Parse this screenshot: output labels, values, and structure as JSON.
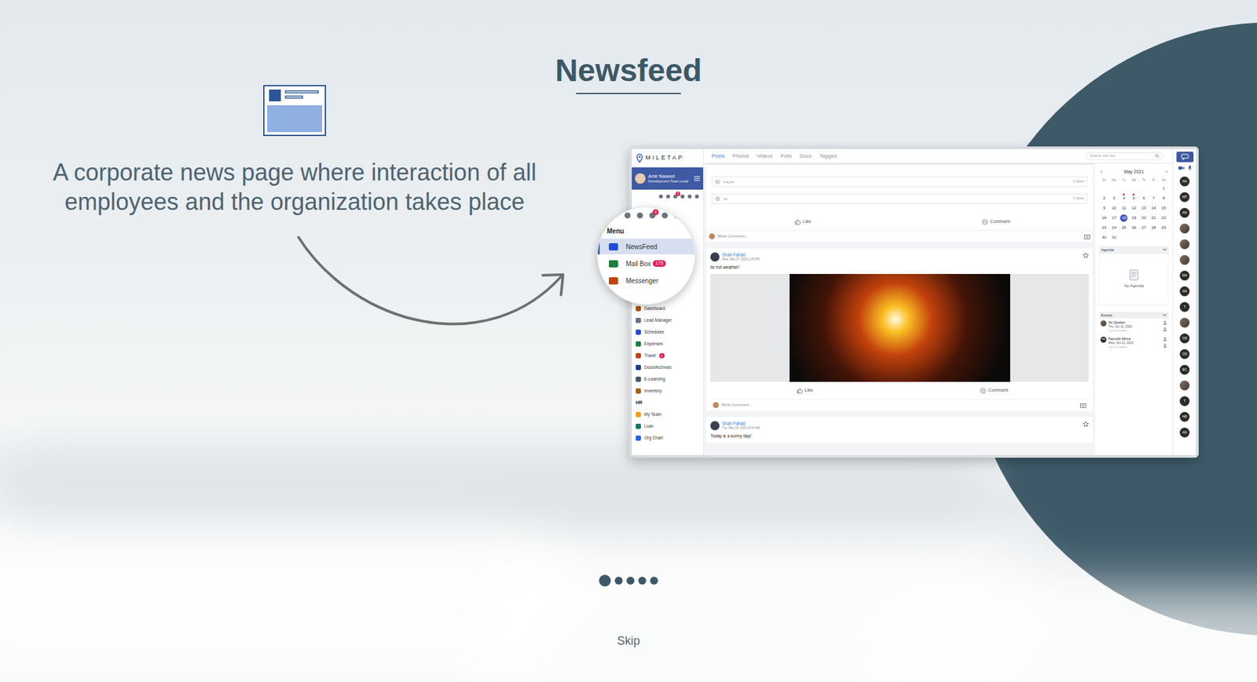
{
  "slide": {
    "title": "Newsfeed",
    "description": "A corporate news page where interaction of all employees and the organization takes place",
    "skip": "Skip"
  },
  "pager": [
    {
      "selected": true
    },
    {
      "selected": false
    },
    {
      "selected": false
    },
    {
      "selected": false
    },
    {
      "selected": false
    }
  ],
  "app": {
    "logo": "MILETAP",
    "user": {
      "name": "Amir Naveed",
      "role": "Development Team Lead"
    },
    "icon_badge": "2",
    "tabs": [
      {
        "label": "Posts",
        "selected": true
      },
      {
        "label": "Photos",
        "selected": false
      },
      {
        "label": "Videos",
        "selected": false
      },
      {
        "label": "Polls",
        "selected": false
      },
      {
        "label": "Docs",
        "selected": false
      },
      {
        "label": "Tagged",
        "selected": false
      }
    ],
    "search": {
      "placeholder": "Search with title"
    },
    "sidebar": [
      {
        "label": "Dashboard",
        "kind": "item"
      },
      {
        "label": "Lead Manager",
        "kind": "item"
      },
      {
        "label": "Schedules",
        "kind": "item"
      },
      {
        "label": "Expenses",
        "kind": "item"
      },
      {
        "label": "Travel",
        "kind": "item",
        "badge": "1"
      },
      {
        "label": "Docs/Archives",
        "kind": "item"
      },
      {
        "label": "E-Learning",
        "kind": "item"
      },
      {
        "label": "Inventory",
        "kind": "item"
      },
      {
        "label": "HR",
        "kind": "section"
      },
      {
        "label": "My Team",
        "kind": "item"
      },
      {
        "label": "Loan",
        "kind": "item"
      },
      {
        "label": "Org Chart",
        "kind": "item"
      }
    ],
    "poll": [
      {
        "option": "maybe",
        "votes": "0 Votes"
      },
      {
        "option": "no",
        "votes": "0 Votes"
      }
    ],
    "actions": {
      "like": "Like",
      "comment": "Comment",
      "write": "Write Comment..."
    },
    "posts": [
      {
        "author": "Shah Fahad",
        "time": "Wed, May 27, 2020 1:25 PM",
        "text": "its hot weather!",
        "kind": "image"
      },
      {
        "author": "Shah Fahad",
        "time": "Tue, May 19, 2020 10:14 AM",
        "text": "Today is a sunny day!",
        "kind": "text"
      }
    ],
    "calendar": {
      "month": "May 2021",
      "prev": "‹",
      "next": "›",
      "weekdays": [
        "Su",
        "Mo",
        "Tu",
        "We",
        "Th",
        "Fr",
        "Sa"
      ],
      "first_weekday": 6,
      "days": [
        {
          "label": "1",
          "selected": false,
          "marked": false
        },
        {
          "label": "2",
          "selected": false,
          "marked": false
        },
        {
          "label": "3",
          "selected": false,
          "marked": false
        },
        {
          "label": "4",
          "selected": false,
          "marked": true
        },
        {
          "label": "5",
          "selected": false,
          "marked": true
        },
        {
          "label": "6",
          "selected": false,
          "marked": false
        },
        {
          "label": "7",
          "selected": false,
          "marked": false
        },
        {
          "label": "8",
          "selected": false,
          "marked": false
        },
        {
          "label": "9",
          "selected": false,
          "marked": false
        },
        {
          "label": "10",
          "selected": false,
          "marked": false
        },
        {
          "label": "11",
          "selected": false,
          "marked": false
        },
        {
          "label": "12",
          "selected": false,
          "marked": false
        },
        {
          "label": "13",
          "selected": false,
          "marked": false
        },
        {
          "label": "14",
          "selected": false,
          "marked": false
        },
        {
          "label": "15",
          "selected": false,
          "marked": false
        },
        {
          "label": "16",
          "selected": false,
          "marked": false
        },
        {
          "label": "17",
          "selected": false,
          "marked": false
        },
        {
          "label": "18",
          "selected": true,
          "marked": false
        },
        {
          "label": "19",
          "selected": false,
          "marked": false
        },
        {
          "label": "20",
          "selected": false,
          "marked": false
        },
        {
          "label": "21",
          "selected": false,
          "marked": false
        },
        {
          "label": "22",
          "selected": false,
          "marked": false
        },
        {
          "label": "23",
          "selected": false,
          "marked": false
        },
        {
          "label": "24",
          "selected": false,
          "marked": false
        },
        {
          "label": "25",
          "selected": false,
          "marked": false
        },
        {
          "label": "26",
          "selected": false,
          "marked": false
        },
        {
          "label": "27",
          "selected": false,
          "marked": false
        },
        {
          "label": "28",
          "selected": false,
          "marked": false
        },
        {
          "label": "29",
          "selected": false,
          "marked": false
        },
        {
          "label": "30",
          "selected": false,
          "marked": false
        },
        {
          "label": "31",
          "selected": false,
          "marked": false
        }
      ]
    },
    "agenda": {
      "title": "Agenda",
      "empty": "No Agenda"
    },
    "events": {
      "title": "Events",
      "items": [
        {
          "name": "Ali Qeeber",
          "date": "Thu, Jun 11, 2020",
          "ago": "1 yrs 10 months",
          "kind": "photo"
        },
        {
          "name": "Farrukh Mirza",
          "date": "Wed, Jun 12, 2019",
          "ago": "1 yrs 12 months",
          "kind": "initials",
          "initials": "FM"
        }
      ]
    },
    "contacts": [
      {
        "kind": "initials",
        "initials": "AN"
      },
      {
        "kind": "initials",
        "initials": "MT"
      },
      {
        "kind": "initials",
        "initials": "AN"
      },
      {
        "kind": "photo"
      },
      {
        "kind": "photo"
      },
      {
        "kind": "photo"
      },
      {
        "kind": "initials",
        "initials": "MA"
      },
      {
        "kind": "initials",
        "initials": "AN"
      },
      {
        "kind": "initials",
        "initials": "T"
      },
      {
        "kind": "photo"
      },
      {
        "kind": "initials",
        "initials": "OS"
      },
      {
        "kind": "initials",
        "initials": "OS"
      },
      {
        "kind": "initials",
        "initials": "EC"
      },
      {
        "kind": "photo"
      },
      {
        "kind": "initials",
        "initials": "T"
      },
      {
        "kind": "initials",
        "initials": "HR"
      },
      {
        "kind": "initials",
        "initials": "AN"
      }
    ]
  },
  "magnifier": {
    "icon_badge": "2",
    "heading": "Menu",
    "items": [
      {
        "label": "NewsFeed",
        "selected": true
      },
      {
        "label": "Mail Box",
        "selected": false,
        "badge": "175"
      },
      {
        "label": "Messenger",
        "selected": false
      }
    ]
  }
}
